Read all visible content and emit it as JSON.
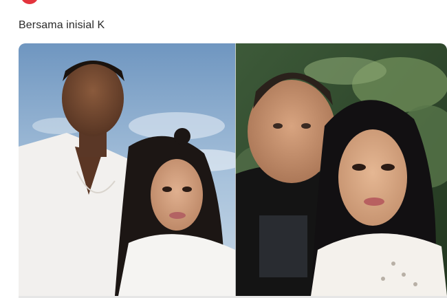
{
  "post": {
    "caption": "Bersama inisial K"
  },
  "media": {
    "photos": [
      {
        "icon": "photo-couple-left"
      },
      {
        "icon": "photo-couple-right"
      }
    ]
  },
  "colors": {
    "brand_red": "#e3343d",
    "text": "#2a2a2a",
    "sky_top": "#7ea3c8",
    "sky_bottom": "#b9cfe3",
    "foliage_dark": "#2f4a2c",
    "foliage_light": "#7b9a63"
  }
}
